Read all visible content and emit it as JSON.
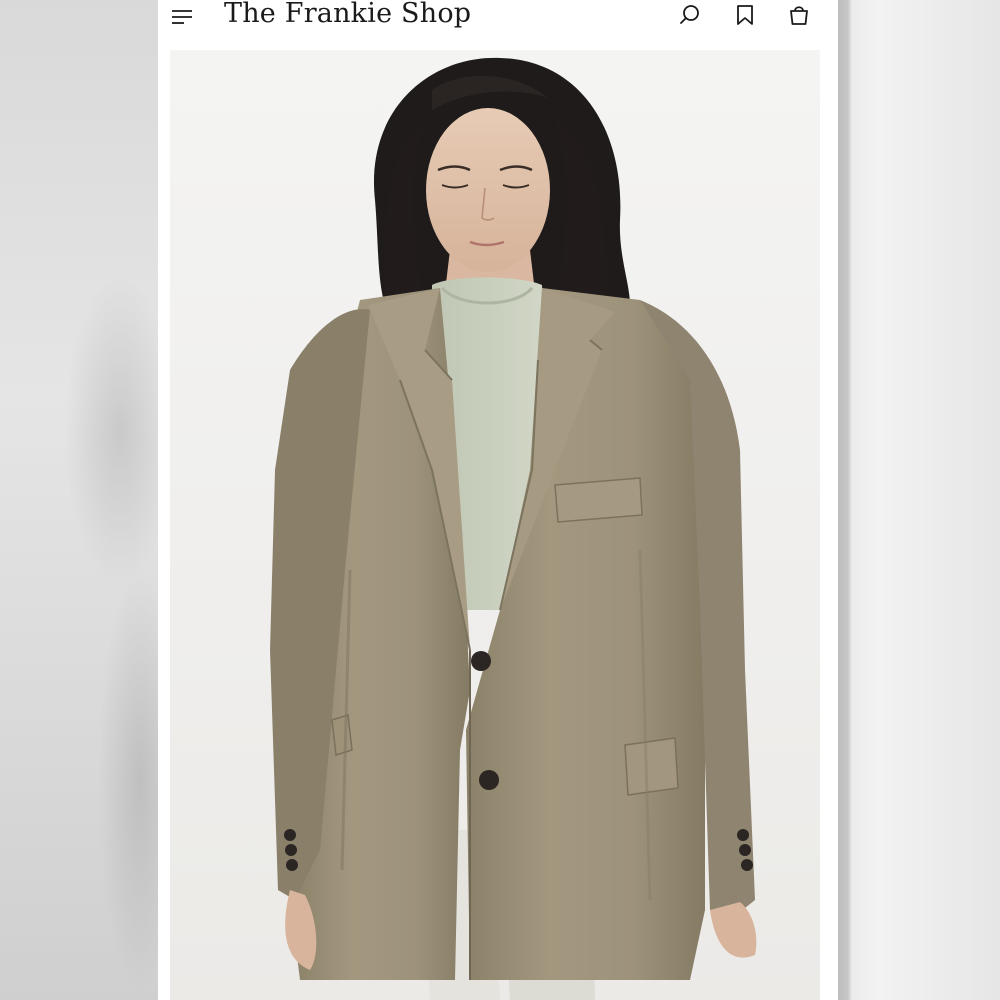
{
  "app": {
    "brand_name": "The Frankie Shop"
  },
  "header": {
    "menu_icon": "hamburger-menu-icon",
    "search_icon": "search-icon",
    "wishlist_icon": "bookmark-icon",
    "bag_icon": "shopping-bag-icon"
  },
  "product": {
    "image_alt": "Model wearing oversized taupe blazer over sage t-shirt and white trousers"
  },
  "colors": {
    "background": "#ffffff",
    "text": "#1a1a1a",
    "blazer": "#9a8f78",
    "tshirt": "#c9cfbd",
    "hair": "#1f1b1a"
  }
}
